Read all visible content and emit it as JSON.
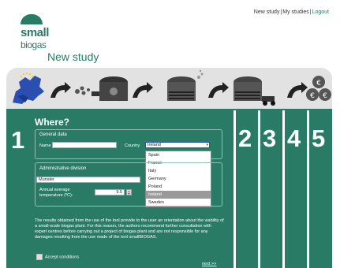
{
  "topnav": {
    "new_study": "New study",
    "my_studies": "My studies",
    "logout": "Logout",
    "sep": "|"
  },
  "logo": {
    "line1": "small",
    "line2": "biogas"
  },
  "page_title": "New study",
  "steps": [
    "1",
    "2",
    "3",
    "4",
    "5"
  ],
  "process_icons": [
    "europe-map-icon",
    "arrow-icon",
    "feedstock-icon",
    "arrow-icon",
    "digester-icon",
    "arrow-icon",
    "biogas-plant-icon",
    "arrow-icon",
    "transport-icon",
    "arrow-icon",
    "money-icon"
  ],
  "where": {
    "heading": "Where?",
    "general": {
      "legend": "General data",
      "name_label": "Name",
      "name_value": "",
      "country_label": "Country",
      "country_value": "Ireland",
      "country_options": [
        "Spain",
        "France",
        "Italy",
        "Germany",
        "Poland",
        "Ireland",
        "Sweden"
      ]
    },
    "admin": {
      "legend": "Administrative division",
      "region_value": "Munster",
      "temp_label_1": "Annual average",
      "temp_label_2": "temperature (ºC):",
      "temp_value": "9.5"
    }
  },
  "disclaimer": "The results obtained from the use of the tool provide to the user an orientation about the viability of a small-scale biogas plant. For this reason, the authors recommend further consultation with expert centres before carrying out a project of biogas plant and are not responsible for any damages resulting from the use made of the tool smallBIOGAS.",
  "accept_label": "Accept conditions",
  "next_label": "next >>",
  "colors": {
    "accent": "#2a7b66",
    "band": "#e2e2e2",
    "dark": "#4a4a4a"
  }
}
